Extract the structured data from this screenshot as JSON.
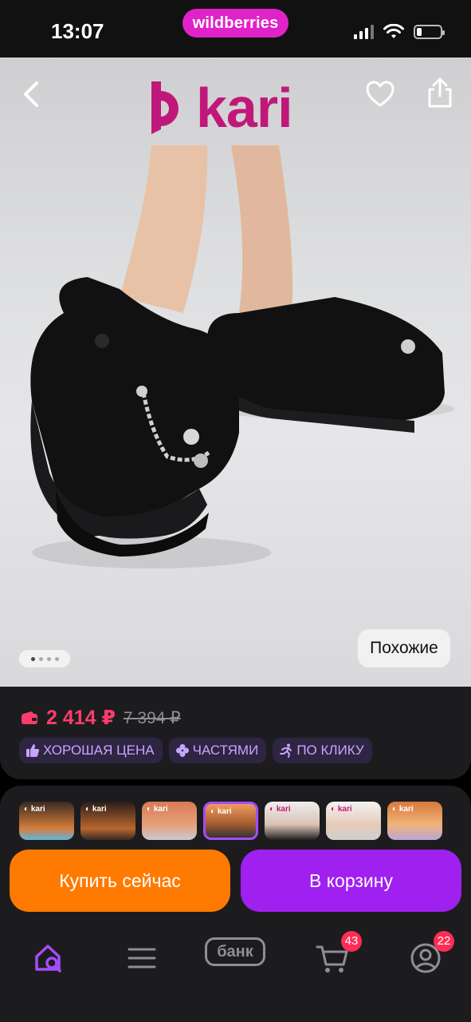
{
  "status_bar": {
    "time": "13:07",
    "brand": "wildberries"
  },
  "product": {
    "brand_logo_text": "kari",
    "similar_label": "Похожие",
    "image_count": 4,
    "current_image_index": 1
  },
  "price": {
    "current": "2 414 ₽",
    "old": "7 394 ₽"
  },
  "badges": [
    {
      "label": "ХОРОШАЯ ЦЕНА",
      "icon": "thumbs-up-icon"
    },
    {
      "label": "ЧАСТЯМИ",
      "icon": "clover-icon"
    },
    {
      "label": "ПО КЛИКУ",
      "icon": "running-icon"
    }
  ],
  "actions": {
    "buy_now": "Купить сейчас",
    "add_to_cart": "В корзину"
  },
  "tabbar": {
    "bank_label": "банк",
    "cart_count": "43",
    "profile_count": "22"
  },
  "colors": {
    "accent_pink": "#e023c8",
    "price_red": "#ff3d6c",
    "buy_orange": "#ff7a00",
    "cart_purple": "#a020f0",
    "kari_magenta": "#c0187a"
  }
}
